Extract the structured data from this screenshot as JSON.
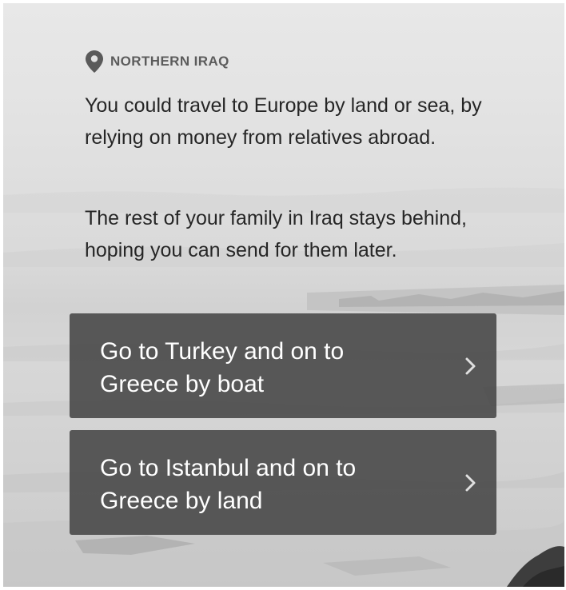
{
  "location": {
    "icon": "map-pin-icon",
    "label": "NORTHERN IRAQ"
  },
  "paragraphs": [
    "You could travel to Europe by land or sea, by relying on money from relatives abroad.",
    "The rest of your family in Iraq stays behind, hoping you can send for them later."
  ],
  "choices": [
    {
      "label": "Go to Turkey and on to Greece by boat",
      "icon": "chevron-right-icon"
    },
    {
      "label": "Go to Istanbul and on to Greece by land",
      "icon": "chevron-right-icon"
    }
  ],
  "colors": {
    "choice_background": "#464646",
    "choice_text": "#ffffff",
    "body_text": "#262626",
    "location_text": "#5c5c5c"
  }
}
